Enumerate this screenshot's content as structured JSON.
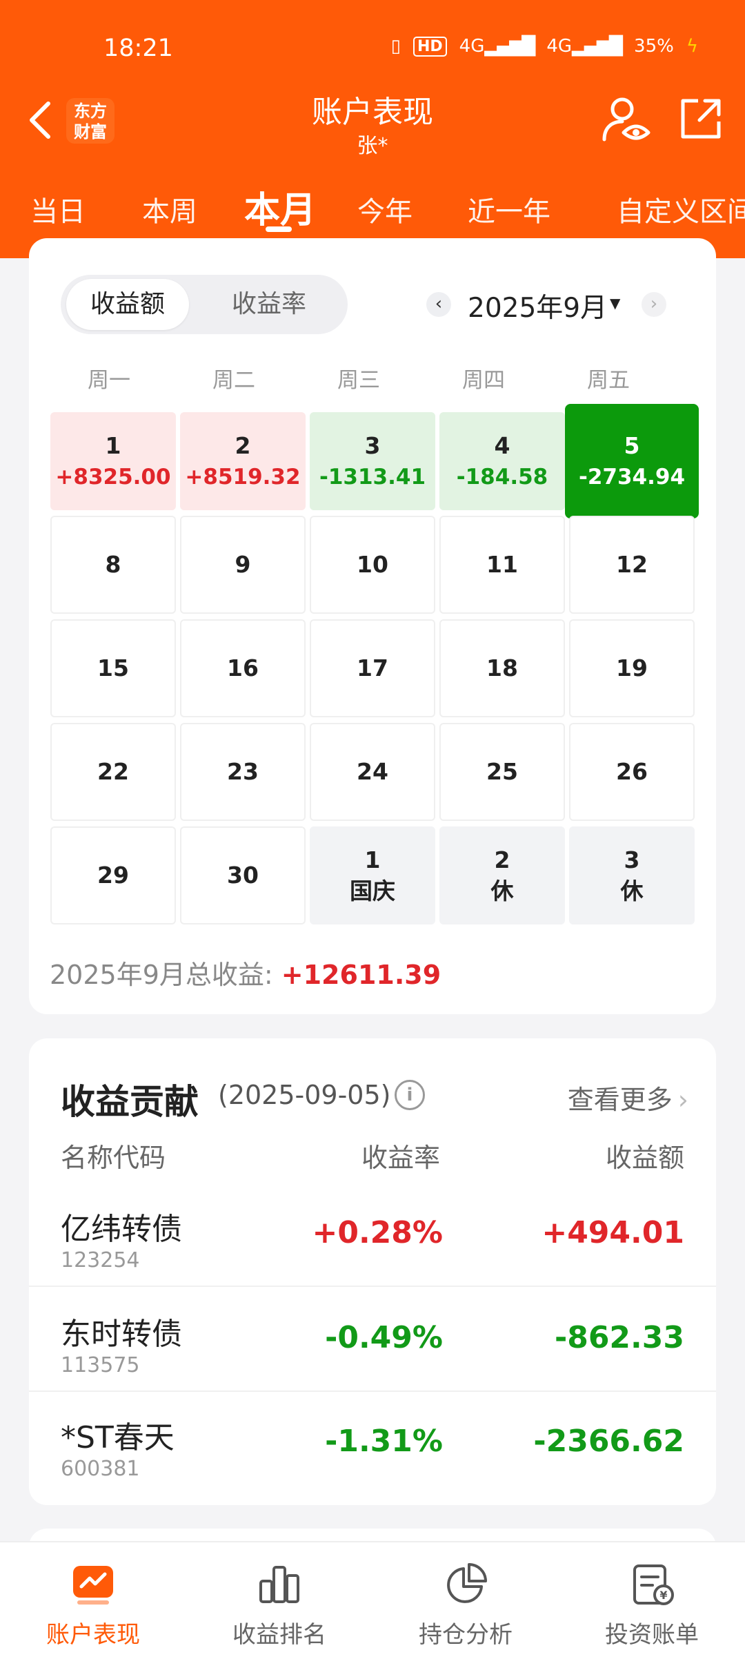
{
  "status_bar": {
    "time": "18:21",
    "hd": "HD",
    "network1": "4G",
    "network2": "4G",
    "battery": "35%"
  },
  "header": {
    "title": "账户表现",
    "subtitle": "张*",
    "logo_line1": "东方",
    "logo_line2": "财富"
  },
  "tabs": [
    "当日",
    "本周",
    "本月",
    "今年",
    "近一年",
    "自定义区间"
  ],
  "active_tab": "本月",
  "calendar": {
    "toggle": {
      "active": "收益额",
      "inactive": "收益率"
    },
    "month_label": "2025年9月",
    "weekdays": [
      "周一",
      "周二",
      "周三",
      "周四",
      "周五"
    ],
    "rows": [
      [
        {
          "day": "1",
          "value": "+8325.00"
        },
        {
          "day": "2",
          "value": "+8519.32"
        },
        {
          "day": "3",
          "value": "-1313.41"
        },
        {
          "day": "4",
          "value": "-184.58"
        },
        {
          "day": "5",
          "value": "-2734.94"
        }
      ],
      [
        {
          "day": "8"
        },
        {
          "day": "9"
        },
        {
          "day": "10"
        },
        {
          "day": "11"
        },
        {
          "day": "12"
        }
      ],
      [
        {
          "day": "15"
        },
        {
          "day": "16"
        },
        {
          "day": "17"
        },
        {
          "day": "18"
        },
        {
          "day": "19"
        }
      ],
      [
        {
          "day": "22"
        },
        {
          "day": "23"
        },
        {
          "day": "24"
        },
        {
          "day": "25"
        },
        {
          "day": "26"
        }
      ],
      [
        {
          "day": "29"
        },
        {
          "day": "30"
        },
        {
          "day": "1",
          "value": "国庆"
        },
        {
          "day": "2",
          "value": "休"
        },
        {
          "day": "3",
          "value": "休"
        }
      ]
    ],
    "total_label": "2025年9月总收益:",
    "total_value": "+12611.39"
  },
  "contribution": {
    "title": "收益贡献",
    "date": "(2025-09-05)",
    "info_symbol": "i",
    "see_more": "查看更多",
    "see_more_chevron": "›",
    "headers": {
      "name": "名称代码",
      "rate": "收益率",
      "amount": "收益额"
    },
    "rows": [
      {
        "name": "亿纬转债",
        "code": "123254",
        "rate": "+0.28%",
        "amount": "+494.01"
      },
      {
        "name": "东时转债",
        "code": "113575",
        "rate": "-0.49%",
        "amount": "-862.33"
      },
      {
        "name": "*ST春天",
        "code": "600381",
        "rate": "-1.31%",
        "amount": "-2366.62"
      }
    ]
  },
  "bottom_nav": {
    "items": [
      {
        "label": "账户表现",
        "icon": "performance-chart-icon"
      },
      {
        "label": "收益排名",
        "icon": "bar-ranking-icon"
      },
      {
        "label": "持仓分析",
        "icon": "pie-chart-icon"
      },
      {
        "label": "投资账单",
        "icon": "bill-icon"
      }
    ],
    "active_index": 0
  },
  "colors": {
    "brand": "#ff5a08",
    "gain": "#e0262a",
    "loss": "#129a18",
    "today": "#0c9a0c"
  }
}
